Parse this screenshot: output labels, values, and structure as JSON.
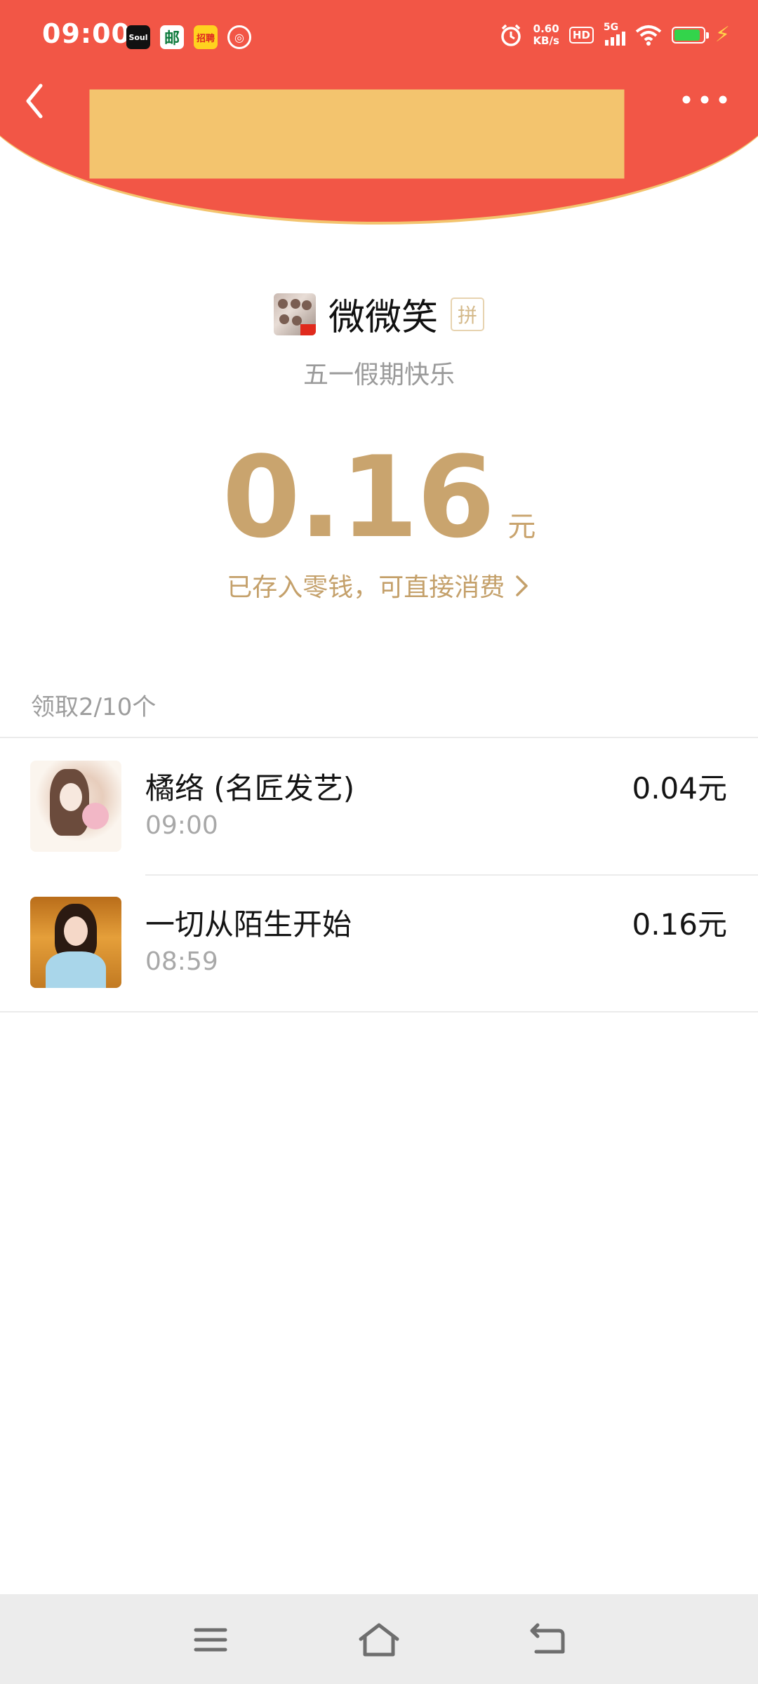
{
  "status_bar": {
    "time": "09:00",
    "net_speed_value": "0.60",
    "net_speed_unit": "KB/s",
    "hd": "HD",
    "network": "5G",
    "notifications": [
      "Soul",
      "邮",
      "招聘",
      "◎"
    ]
  },
  "envelope": {
    "sender_name": "微微笑",
    "sender_badge": "拼",
    "greeting": "五一假期快乐",
    "amount": "0.16",
    "amount_unit": "元",
    "saved_link": "已存入零钱，可直接消费"
  },
  "claims": {
    "summary": "领取2/10个",
    "items": [
      {
        "name": "橘络 (名匠发艺)",
        "time": "09:00",
        "amount": "0.04元"
      },
      {
        "name": "一切从陌生开始",
        "time": "08:59",
        "amount": "0.16元"
      }
    ]
  },
  "colors": {
    "header_red": "#f25646",
    "gold_text": "#c9a46e",
    "header_border": "#f3c46e"
  }
}
